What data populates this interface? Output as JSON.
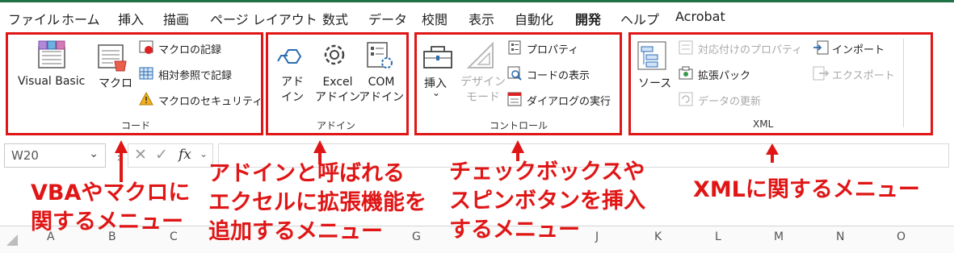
{
  "tabs": [
    "ファイル",
    "ホーム",
    "挿入",
    "描画",
    "ページ レイアウト",
    "数式",
    "データ",
    "校閲",
    "表示",
    "自動化",
    "開発",
    "ヘルプ",
    "Acrobat"
  ],
  "groups": {
    "code": {
      "label": "コード",
      "visual_basic": "Visual Basic",
      "macro": "マクロ",
      "record_macro": "マクロの記録",
      "relative_ref": "相対参照で記録",
      "macro_security": "マクロのセキュリティ"
    },
    "addin": {
      "label": "アドイン",
      "addin_line1": "アド",
      "addin_line2": "イン",
      "excel_line1": "Excel",
      "excel_line2": "アドイン",
      "com_line1": "COM",
      "com_line2": "アドイン"
    },
    "control": {
      "label": "コントロール",
      "insert": "挿入",
      "insert_caret": "⌄",
      "design_line1": "デザイン",
      "design_line2": "モード",
      "properties": "プロパティ",
      "view_code": "コードの表示",
      "run_dialog": "ダイアログの実行"
    },
    "xml": {
      "label": "XML",
      "source": "ソース",
      "map_properties": "対応付けのプロパティ",
      "expansion_packs": "拡張パック",
      "refresh_data": "データの更新",
      "import": "インポート",
      "export": "エクスポート"
    }
  },
  "formula_bar": {
    "name_box": "W20",
    "fx": "fx"
  },
  "columns": [
    "A",
    "B",
    "C",
    "G",
    "J",
    "K",
    "L",
    "M",
    "N",
    "O"
  ],
  "annotations": {
    "vba_line1": "VBAやマクロに",
    "vba_line2": "関するメニュー",
    "addin_line1": "アドインと呼ばれる",
    "addin_line2": "エクセルに拡張機能を",
    "addin_line3": "追加するメニュー",
    "control_line1": "チェックボックスや",
    "control_line2": "スピンボタンを挿入",
    "control_line3": "するメニュー",
    "xml_line1": "XMLに関するメニュー"
  },
  "colors": {
    "accent": "#217346",
    "highlight": "#e01616",
    "icon_blue": "#2b6cb0"
  }
}
